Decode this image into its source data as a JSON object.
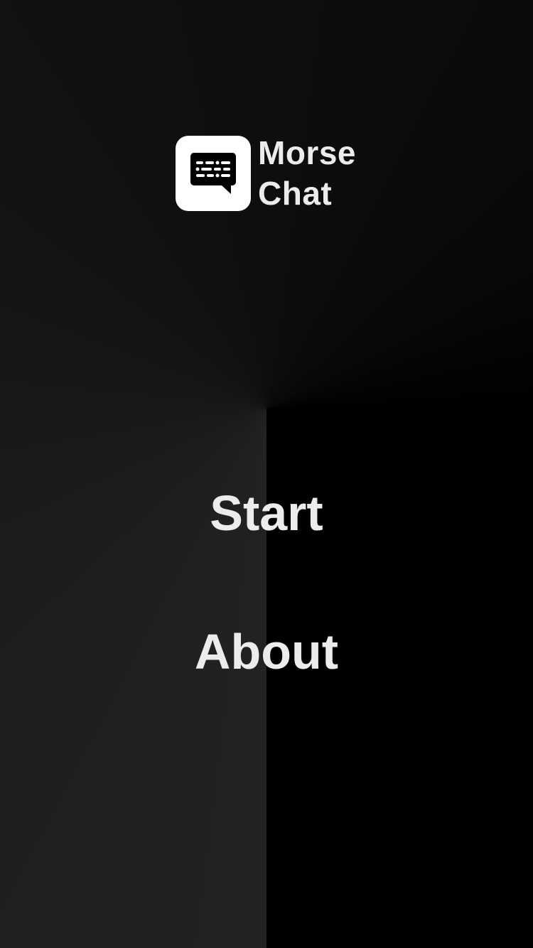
{
  "app": {
    "title_line1": "Morse",
    "title_line2": "Chat",
    "logo_icon": "morse-chat-bubble-icon"
  },
  "menu": {
    "start_label": "Start",
    "about_label": "About"
  },
  "colors": {
    "text": "#ececec",
    "logo_tile": "#ffffff",
    "background_dark": "#000000",
    "background_light": "#222222"
  }
}
